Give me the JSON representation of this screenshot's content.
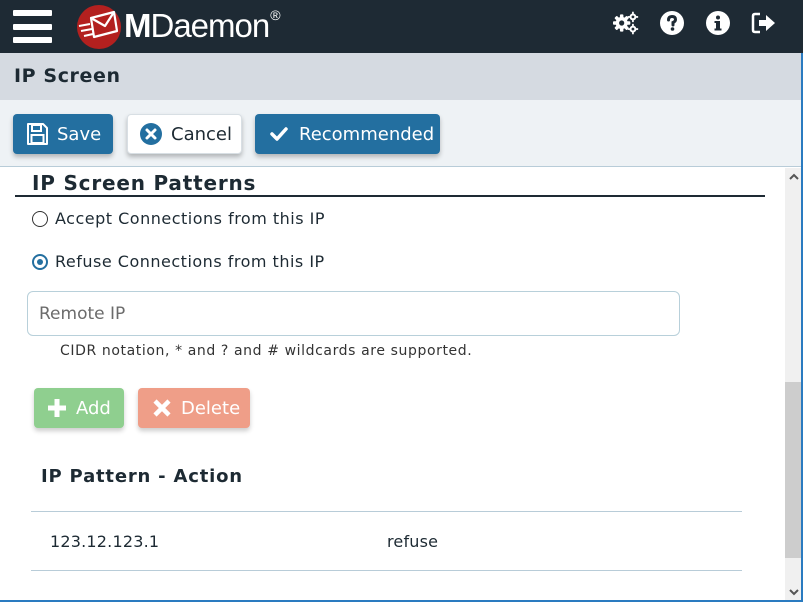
{
  "header": {
    "brand_name_bold": "M",
    "brand_name_rest": "Daemon",
    "brand_reg_mark": "®",
    "icons": [
      "settings-gears-icon",
      "help-icon",
      "info-icon",
      "logout-icon"
    ]
  },
  "page": {
    "title": "IP Screen"
  },
  "toolbar": {
    "save_label": "Save",
    "cancel_label": "Cancel",
    "recommended_label": "Recommended"
  },
  "section": {
    "title": "IP Screen Patterns",
    "radio_options": [
      {
        "label": "Accept Connections from this IP",
        "checked": false
      },
      {
        "label": "Refuse Connections from this IP",
        "checked": true
      }
    ],
    "remote_ip_value": "",
    "remote_ip_placeholder": "Remote IP",
    "hint": "CIDR notation, * and ? and # wildcards are supported.",
    "add_label": "Add",
    "delete_label": "Delete"
  },
  "table": {
    "header": "IP Pattern - Action",
    "rows": [
      {
        "ip": "123.12.123.1",
        "action": "refuse"
      }
    ]
  },
  "colors": {
    "topbar": "#1e2a34",
    "primary": "#236fa0",
    "add": "#8fcf8f",
    "delete": "#ef9e88",
    "logo_red": "#b3201f"
  }
}
